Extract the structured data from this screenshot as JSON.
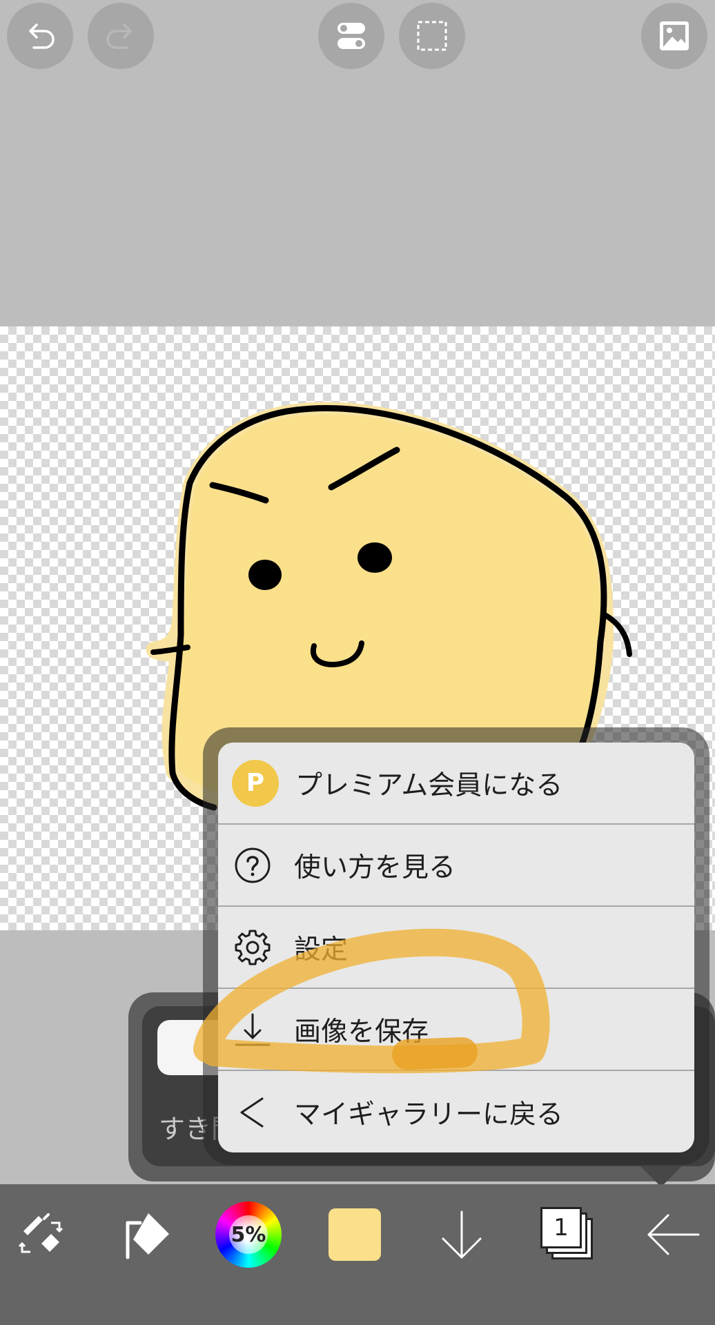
{
  "toolbar_top": {
    "buttons": [
      "undo-icon",
      "redo-icon",
      "toggle-icon",
      "selection-icon",
      "image-icon"
    ]
  },
  "menu": {
    "items": [
      {
        "icon": "premium-icon",
        "badge": "P",
        "label": "プレミアム会員になる"
      },
      {
        "icon": "help-icon",
        "label": "使い方を見る"
      },
      {
        "icon": "gear-icon",
        "label": "設定"
      },
      {
        "icon": "download-icon",
        "label": "画像を保存"
      },
      {
        "icon": "back-chevron-icon",
        "label": "マイギャラリーに戻る"
      }
    ]
  },
  "background_panel": {
    "partial_text": "すき間"
  },
  "bottom_toolbar": {
    "opacity_label": "5%",
    "current_color": "#fae08b",
    "layer_count": "1"
  },
  "colors": {
    "highlight": "#f0b030",
    "character_fill": "#fae08b"
  }
}
